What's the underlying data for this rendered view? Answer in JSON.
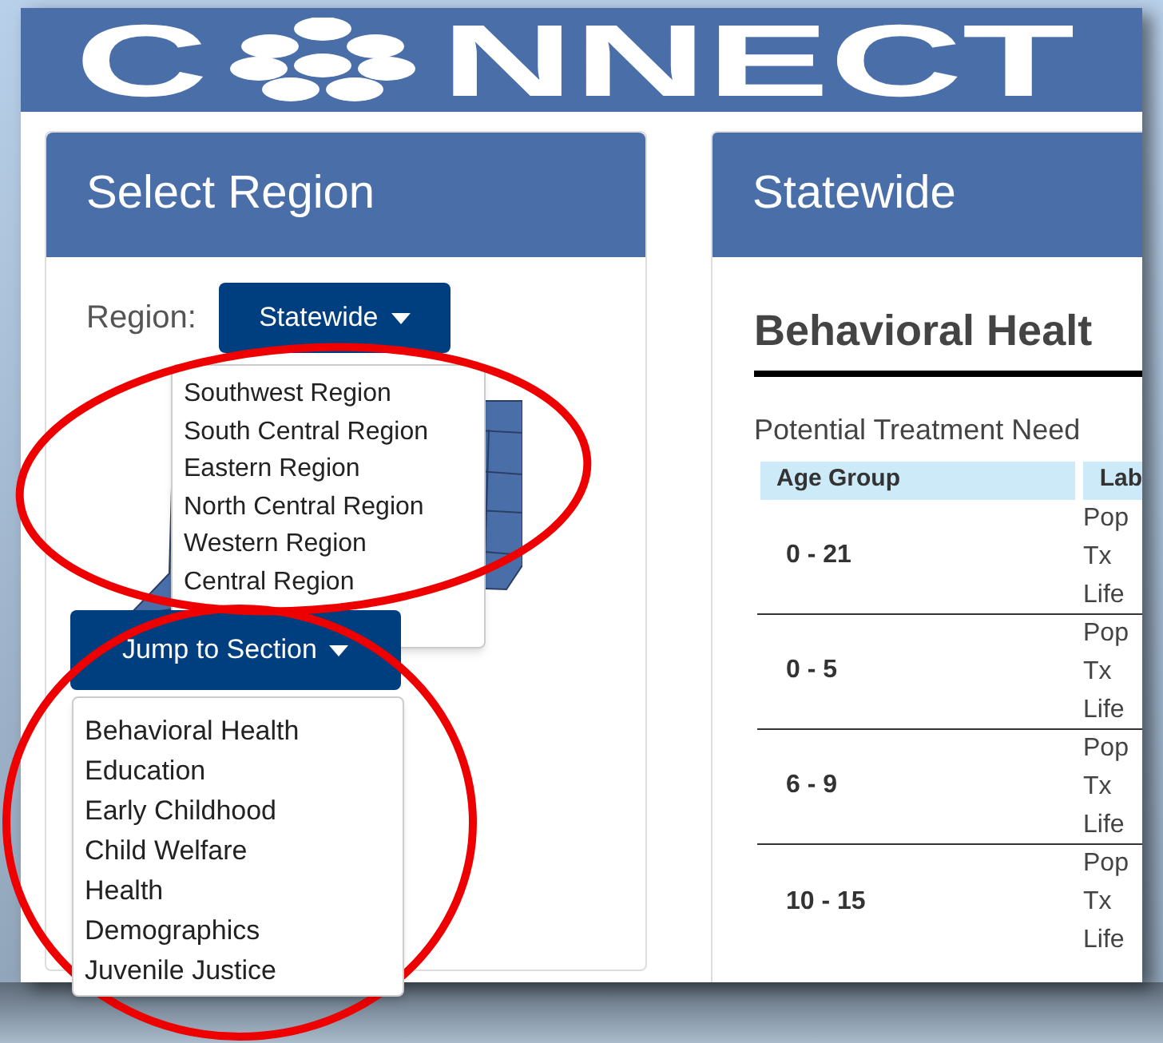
{
  "logo": {
    "text_start": "C",
    "text_end": "NNECT"
  },
  "left_panel": {
    "title": "Select Region",
    "region_label": "Region:",
    "region_button": {
      "label": "Statewide"
    },
    "region_menu": [
      "Southwest Region",
      "South Central Region",
      "Eastern Region",
      "North Central Region",
      "Western Region",
      "Central Region"
    ],
    "section_button": {
      "label": "Jump to Section"
    },
    "section_menu": [
      "Behavioral Health",
      "Education",
      "Early Childhood",
      "Child Welfare",
      "Health",
      "Demographics",
      "Juvenile Justice"
    ]
  },
  "right_panel": {
    "title": "Statewide",
    "heading": "Behavioral Healt",
    "subheading": "Potential Treatment Need",
    "table": {
      "columns": [
        "Age Group",
        "Lab"
      ],
      "rows": [
        {
          "age_group": "0 - 21",
          "labels": [
            "Pop",
            "Tx",
            "Life"
          ]
        },
        {
          "age_group": "0 - 5",
          "labels": [
            "Pop",
            "Tx",
            "Life"
          ]
        },
        {
          "age_group": "6 - 9",
          "labels": [
            "Pop",
            "Tx",
            "Life"
          ]
        },
        {
          "age_group": "10 - 15",
          "labels": [
            "Pop",
            "Tx",
            "Life"
          ]
        }
      ]
    }
  },
  "annotations": [
    {
      "kind": "ellipse"
    },
    {
      "kind": "ellipse"
    }
  ]
}
